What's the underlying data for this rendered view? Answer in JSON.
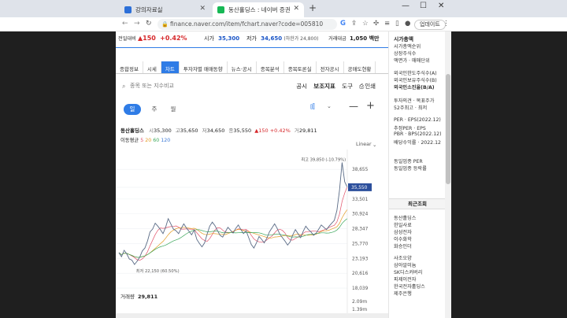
{
  "browser": {
    "tabs": [
      {
        "title": "강의자료실",
        "active": false,
        "favicon_color": "#2c6fd8"
      },
      {
        "title": "동산홀딩스 : 네이버 증권",
        "active": true,
        "favicon_color": "#16b855"
      }
    ],
    "url": "finance.naver.com/item/fchart.naver?code=005810",
    "update_label": "업데이트"
  },
  "stock": {
    "change_label": "전일대비",
    "change_value": "▲150",
    "change_pct": "+0.42%",
    "open_label": "시가",
    "open_value": "35,300",
    "low_label": "저가",
    "low_value": "34,650",
    "low_limit_text": "(하한가 24,800)",
    "amount_label": "거래대금",
    "amount_value": "1,050 백만"
  },
  "nav_tabs": [
    "종합정보",
    "시세",
    "차트",
    "투자자별 매매동향",
    "뉴스·공시",
    "종목분석",
    "종목토론실",
    "전자공시",
    "공매도현황"
  ],
  "nav_selected": 2,
  "search": {
    "placeholder": "종목 또는 지수비교",
    "tools": [
      "공시",
      "보조지표",
      "도구",
      "인쇄"
    ]
  },
  "periods": [
    "일",
    "주",
    "월"
  ],
  "chart_header": {
    "name": "동산홀딩스",
    "open_label": "시",
    "open": "35,300",
    "high_label": "고",
    "high": "35,650",
    "low_label": "저",
    "low": "34,650",
    "close_label": "종",
    "close": "35,550",
    "change": "▲150 +0.42%",
    "volume_label": "거",
    "volume": "29,811",
    "ma_label": "이동평균",
    "ma_values": [
      "5",
      "20",
      "60",
      "120"
    ],
    "scale": "Linear"
  },
  "chart_data": {
    "type": "line",
    "y_ticks": [
      "38,655",
      "35,550",
      "33,501",
      "30,924",
      "28,347",
      "25,770",
      "23,193",
      "20,616",
      "18,039"
    ],
    "current_price_tag": "35,550",
    "high_annotation": "최고 39,850 (-10.79%)",
    "low_annotation": "최저 22,150 (60.50%)",
    "volume_label": "거래량",
    "volume_value": "29,811",
    "volume_ticks": [
      "2.09m",
      "1.39m"
    ],
    "close": [
      24200,
      23500,
      24600,
      24000,
      23100,
      22900,
      22150,
      22700,
      23400,
      24500,
      25000,
      26200,
      27800,
      28300,
      29300,
      28800,
      28200,
      27500,
      28600,
      30100,
      29200,
      28300,
      28000,
      27500,
      28400,
      29200,
      28500,
      27900,
      27300,
      28100,
      26500,
      25800,
      25200,
      25900,
      27400,
      28800,
      29500,
      28900,
      28000,
      27200,
      26900,
      27800,
      28600,
      28100,
      27600,
      28400,
      29000,
      28200,
      27500,
      28000,
      26800,
      25600,
      25000,
      25900,
      27000,
      26500,
      25900,
      26700,
      27800,
      28500,
      29200,
      28400,
      27400,
      26800,
      26200,
      25500,
      26100,
      27300,
      28200,
      27500,
      26800,
      27900,
      28800,
      28200,
      27800,
      27200,
      27600,
      28300,
      29000,
      28600,
      28200,
      28800,
      29300,
      29800,
      31500,
      35000,
      39850,
      36500,
      35550
    ]
  },
  "sidebar": {
    "head1": "시가총액",
    "lines1": [
      "시가총액순위",
      "상장주식수",
      "액면가 · 매매단위"
    ],
    "lines2": [
      "외국인한도주식수(A)",
      "외국인보유주식수(B)",
      "외국인소진율(B/A)"
    ],
    "lines3": [
      "투자의견 · 목표주가",
      "52주최고 · 최저"
    ],
    "lines4": [
      "PER · EPS(2022.12)",
      "추정PER · EPS",
      "PBR · BPS(2022.12)",
      "배당수익률 · 2022.12"
    ],
    "lines5": [
      "동일업종 PER",
      "동일업종 등락률"
    ],
    "recent_title": "최근조회",
    "recent": [
      "동산홀딩스",
      "한일사료",
      "삼성전자",
      "이수화학",
      "화승인더",
      "사조오양",
      "삼아알미늄",
      "SK디스커버리",
      "피제이전자",
      "한국전자홀딩스",
      "제주은행"
    ]
  }
}
